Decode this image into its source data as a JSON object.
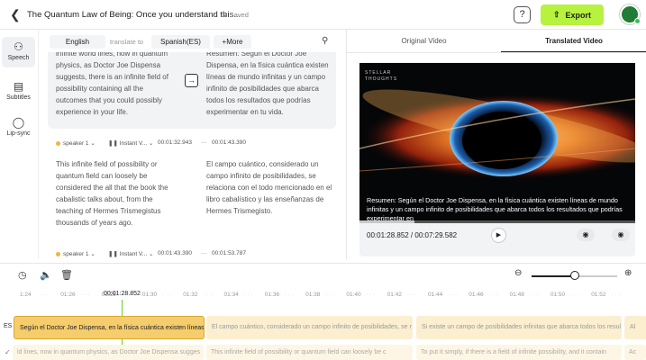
{
  "header": {
    "back_icon": "chevron-left-icon",
    "title": "The Quantum Law of Being: Once you understand this...",
    "saved_label": "Saved",
    "help_label": "?",
    "export_label": "Export"
  },
  "sidebar": {
    "items": [
      {
        "label": "Speech",
        "icon": "speech-icon"
      },
      {
        "label": "Subtitles",
        "icon": "subtitles-icon"
      },
      {
        "label": "Lip-sync",
        "icon": "lip-sync-icon"
      }
    ]
  },
  "translation_bar": {
    "source_language": "English",
    "translate_to_label": "translate to",
    "target_language": "Spanish(ES)",
    "more_label": "More"
  },
  "segments": [
    {
      "source_text": "infinite world lines, now in quantum physics, as Doctor Joe Dispensa suggests, there is an infinite field of possibility containing all the outcomes that you could possibly experience in your life.",
      "translated_text": "Resumen: Según el Doctor Joe Dispensa, en la física cuántica existen líneas de mundo infinitas y un campo infinito de posibilidades que abarca todos los resultados que podrías experimentar en tu vida."
    },
    {
      "speaker": "speaker 1",
      "voice": "Instant V...",
      "start": "00:01:32.943",
      "end": "00:01:43.390",
      "source_text": "This infinite field of possibility or quantum field can loosely be considered the all that the book the cabalistic talks about, from the teaching of Hermes Trismegistus thousands of years ago.",
      "translated_text": "El campo cuántico, considerado un campo infinito de posibilidades, se relaciona con el todo mencionado en el libro cabalístico y las enseñanzas de Hermes Trismegisto."
    },
    {
      "speaker": "speaker 1",
      "voice": "Instant V...",
      "start": "00:01:43.390",
      "end": "00:01:53.787"
    }
  ],
  "video_panel": {
    "tab_original": "Original Video",
    "tab_translated": "Translated Video",
    "brand": "STELLAR THOUGHTS",
    "subtitle": "Resumen: Según el Doctor Joe Dispensa, en la física cuántica existen líneas de mundo infinitas y un campo infinito de posibilidades que abarca todos los resultados que podrías experimentar en",
    "current_time": "00:01:28.852",
    "total_time": "00:07:29.582",
    "time_display": "00:01:28.852 / 00:07:29.582",
    "progress_fraction": 0.2
  },
  "timeline": {
    "playhead_time": "00:01:28.852",
    "zoom_fraction": 0.5,
    "ticks": [
      "1:24",
      "01:26",
      "01:28",
      "01:30",
      "01:32",
      "01:34",
      "01:36",
      "01:38",
      "01:40",
      "01:42",
      "01:44",
      "01:46",
      "01:48",
      "01:50",
      "01:52"
    ],
    "track_label": "ES",
    "clips": [
      "Según el Doctor Joe Dispensa, en la física cuántica existen líneas de m",
      "El campo cuántico, considerado un campo infinito de posibilidades, se r",
      "Si existe un campo de posibilidades infinitas que abarca todos los resul",
      "Al"
    ],
    "original_clips": [
      "ld lines, now in quantum physics, as Doctor Joe Dispensa sugges",
      "This infinite field of possibility or quantum field can loosely be c",
      "To put it simply, if there is a field of infinite possibility, and it contain",
      "Ac"
    ]
  }
}
